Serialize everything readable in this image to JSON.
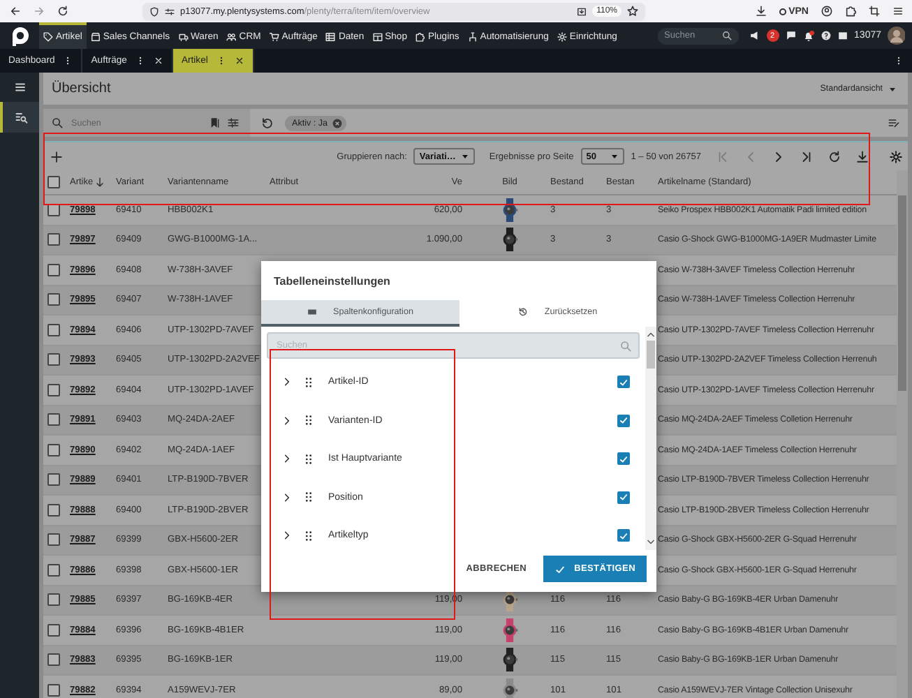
{
  "browser": {
    "host": "p13077.my.plentysystems.com",
    "path": "/plenty/terra/item/item/overview",
    "zoom": "110%",
    "vpn": "VPN"
  },
  "nav": {
    "items": [
      {
        "label": "Artikel",
        "selected": true
      },
      {
        "label": "Sales Channels",
        "selected": false
      },
      {
        "label": "Waren",
        "selected": false
      },
      {
        "label": "CRM",
        "selected": false
      },
      {
        "label": "Aufträge",
        "selected": false
      },
      {
        "label": "Daten",
        "selected": false
      },
      {
        "label": "Shop",
        "selected": false
      },
      {
        "label": "Plugins",
        "selected": false
      },
      {
        "label": "Automatisierung",
        "selected": false
      },
      {
        "label": "Einrichtung",
        "selected": false
      }
    ],
    "search": {
      "placeholder": "Suchen"
    },
    "badge": "2",
    "account": "13077"
  },
  "tabs": [
    {
      "label": "Dashboard",
      "selected": false,
      "closable": false
    },
    {
      "label": "Aufträge",
      "selected": false,
      "closable": true
    },
    {
      "label": "Artikel",
      "selected": true,
      "closable": true
    }
  ],
  "page": {
    "title": "Übersicht",
    "view": "Standardansicht"
  },
  "filter": {
    "search": {
      "placeholder": "Suchen"
    },
    "chips": [
      {
        "label": "Aktiv : Ja"
      }
    ]
  },
  "toolbar": {
    "group_label": "Gruppieren nach:",
    "group_value": "Variati…",
    "per_page_label": "Ergebnisse pro Seite",
    "per_page_value": "50",
    "range": "1 – 50 von 26757",
    "pager": [
      {
        "kind": "first",
        "disabled": true
      },
      {
        "kind": "prev",
        "disabled": true
      },
      {
        "kind": "next",
        "disabled": false
      },
      {
        "kind": "last",
        "disabled": false
      }
    ]
  },
  "table": {
    "all_checked": false,
    "columns": [
      {
        "label": "Artike",
        "sorted": true
      },
      {
        "label": "Variant",
        "sorted": false
      },
      {
        "label": "Variantenname",
        "sorted": false
      },
      {
        "label": "Attribut",
        "sorted": false
      },
      {
        "label": "Ve",
        "sorted": false
      },
      {
        "label": "Bild",
        "sorted": false
      },
      {
        "label": "Bestand",
        "sorted": false
      },
      {
        "label": "Bestan",
        "sorted": false
      },
      {
        "label": "Artikelname (Standard)",
        "sorted": false
      }
    ],
    "rows": [
      {
        "checked": false,
        "item_id": "79898",
        "variant_id": "69410",
        "variant_name": "HBB002K1",
        "price": "620,00",
        "stock": "3",
        "stock_2": "3",
        "name": "Seiko Prospex HBB002K1 Automatik Padi limited edition"
      },
      {
        "checked": false,
        "item_id": "79897",
        "variant_id": "69409",
        "variant_name": "GWG-B1000MG-1A...",
        "price": "1.090,00",
        "stock": "3",
        "stock_2": "3",
        "name": "Casio G-Shock GWG-B1000MG-1A9ER Mudmaster Limite"
      },
      {
        "checked": false,
        "item_id": "79896",
        "variant_id": "69408",
        "variant_name": "W-738H-3AVEF",
        "name": "Casio W-738H-3AVEF Timeless Collection Herrenuhr"
      },
      {
        "checked": false,
        "item_id": "79895",
        "variant_id": "69407",
        "variant_name": "W-738H-1AVEF",
        "name": "Casio W-738H-1AVEF Timeless Collection Herrenuhr"
      },
      {
        "checked": false,
        "item_id": "79894",
        "variant_id": "69406",
        "variant_name": "UTP-1302PD-7AVEF",
        "name": "Casio UTP-1302PD-7AVEF Timeless Collection Herrenuhr"
      },
      {
        "checked": false,
        "item_id": "79893",
        "variant_id": "69405",
        "variant_name": "UTP-1302PD-2A2VEF",
        "name": "Casio UTP-1302PD-2A2VEF Timeless Collection Herrenuh"
      },
      {
        "checked": false,
        "item_id": "79892",
        "variant_id": "69404",
        "variant_name": "UTP-1302PD-1AVEF",
        "name": "Casio UTP-1302PD-1AVEF Timeless Collection Herrenuhr"
      },
      {
        "checked": false,
        "item_id": "79891",
        "variant_id": "69403",
        "variant_name": "MQ-24DA-2AEF",
        "name": "Casio MQ-24DA-2AEF Timeless Colletion Herrenuhr"
      },
      {
        "checked": false,
        "item_id": "79890",
        "variant_id": "69402",
        "variant_name": "MQ-24DA-1AEF",
        "name": "Casio MQ-24DA-1AEF Timeless Collection Herrenuhr"
      },
      {
        "checked": false,
        "item_id": "79889",
        "variant_id": "69401",
        "variant_name": "LTP-B190D-7BVER",
        "name": "Casio LTP-B190D-7BVER Timeless Collection Herrenuhr"
      },
      {
        "checked": false,
        "item_id": "79888",
        "variant_id": "69400",
        "variant_name": "LTP-B190D-2BVER",
        "name": "Casio LTP-B190D-2BVER Timeless Collection Herrenuhr"
      },
      {
        "checked": false,
        "item_id": "79887",
        "variant_id": "69399",
        "variant_name": "GBX-H5600-2ER",
        "name": "Casio G-Shock GBX-H5600-2ER G-Squad Herrenuhr"
      },
      {
        "checked": false,
        "item_id": "79886",
        "variant_id": "69398",
        "variant_name": "GBX-H5600-1ER",
        "name": "Casio G-Shock GBX-H5600-1ER G-Squad Herrenuhr"
      },
      {
        "checked": false,
        "item_id": "79885",
        "variant_id": "69397",
        "variant_name": "BG-169KB-4ER",
        "price": "119,00",
        "stock": "116",
        "stock_2": "116",
        "name": "Casio Baby-G BG-169KB-4ER Urban Damenuhr"
      },
      {
        "checked": false,
        "item_id": "79884",
        "variant_id": "69396",
        "variant_name": "BG-169KB-4B1ER",
        "price": "119,00",
        "stock": "116",
        "stock_2": "116",
        "name": "Casio Baby-G BG-169KB-4B1ER Urban Damenuhr"
      },
      {
        "checked": false,
        "item_id": "79883",
        "variant_id": "69395",
        "variant_name": "BG-169KB-1ER",
        "price": "119,00",
        "stock": "115",
        "stock_2": "115",
        "name": "Casio Baby-G BG-169KB-1ER Urban Damenuhr"
      },
      {
        "checked": false,
        "item_id": "79882",
        "variant_id": "69394",
        "variant_name": "A159WEVJ-7ER",
        "price": "89,00",
        "stock": "101",
        "stock_2": "101",
        "name": "Casio A159WEVJ-7ER Vintage Collection Unisexuhr"
      }
    ]
  },
  "dialog": {
    "title": "Tabelleneinstellungen",
    "tabs": [
      {
        "label": "Spaltenkonfiguration",
        "selected": true
      },
      {
        "label": "Zurücksetzen",
        "selected": false
      }
    ],
    "search": {
      "placeholder": "Suchen"
    },
    "columns": [
      {
        "label": "Artikel-ID",
        "checked": true
      },
      {
        "label": "Varianten-ID",
        "checked": true
      },
      {
        "label": "Ist Hauptvariante",
        "checked": true
      },
      {
        "label": "Position",
        "checked": true
      },
      {
        "label": "Artikeltyp",
        "checked": true
      }
    ],
    "cancel": "ABBRECHEN",
    "confirm": "BESTÄTIGEN"
  }
}
